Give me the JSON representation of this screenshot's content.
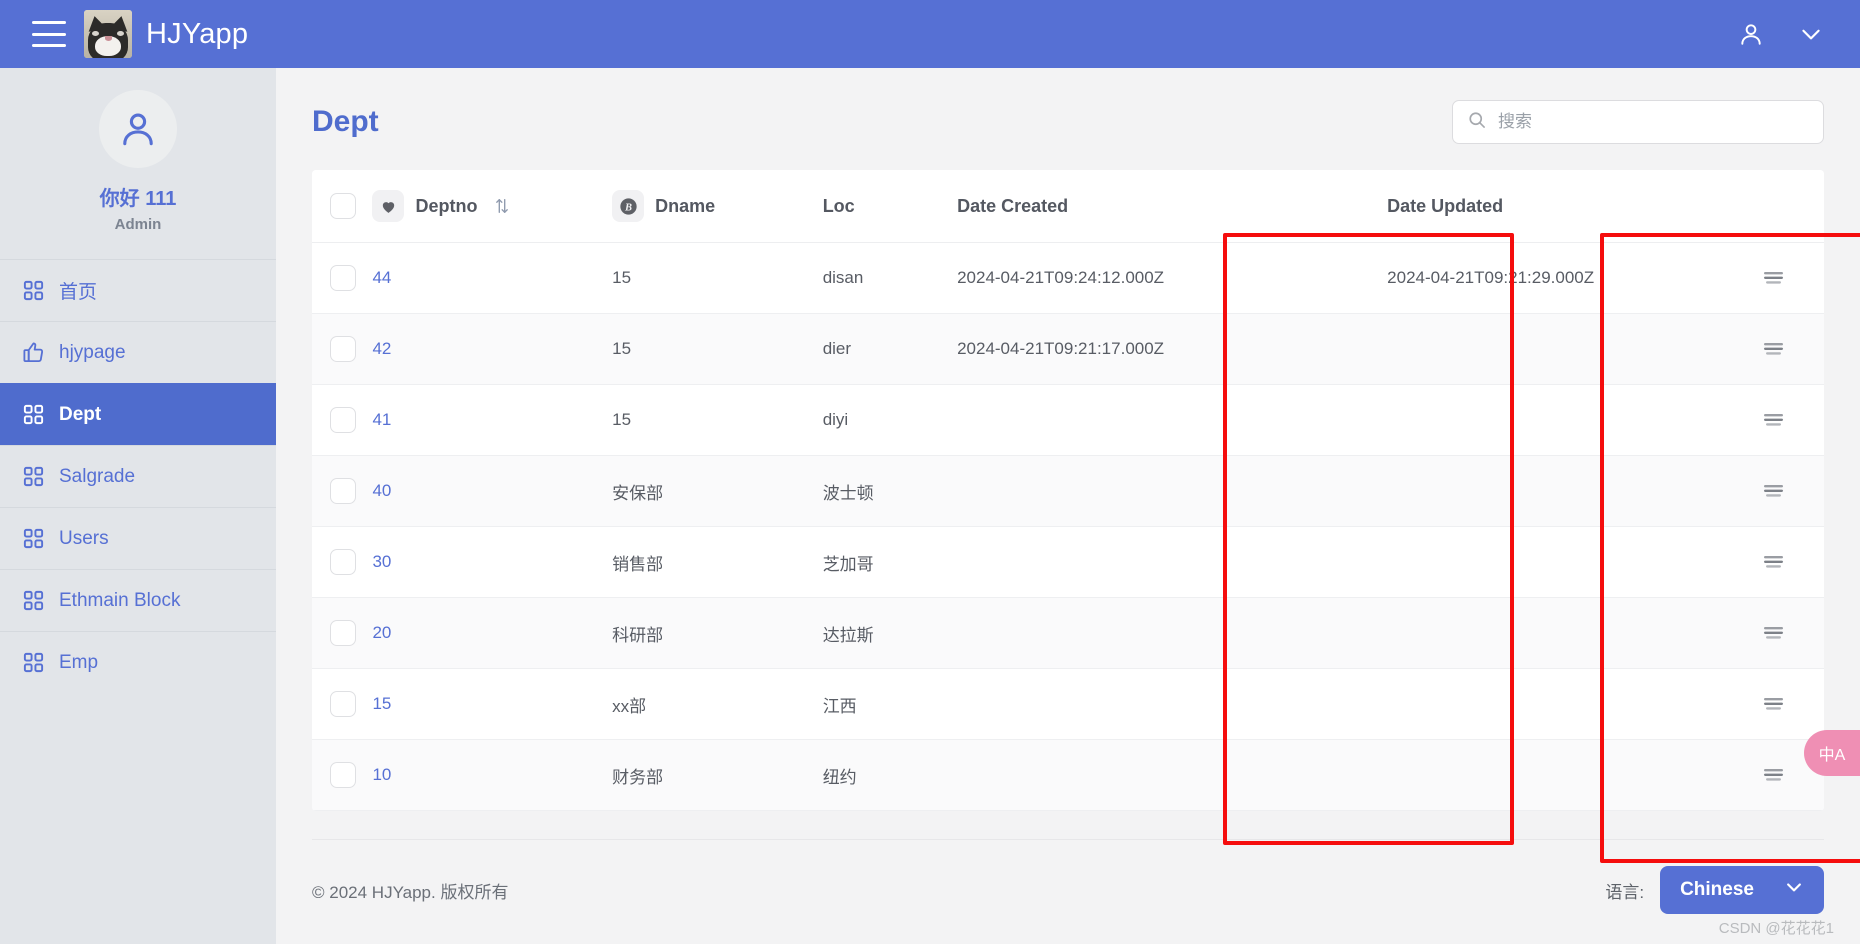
{
  "topbar": {
    "menu_icon": "hamburger-icon",
    "brand_title": "HJYapp",
    "account_icon": "person-icon",
    "chevron_icon": "chevron-down-icon"
  },
  "sidebar": {
    "avatar_icon": "person-icon",
    "greeting": "你好 111",
    "role": "Admin",
    "items": [
      {
        "label": "首页",
        "icon": "grid-icon",
        "active": false
      },
      {
        "label": "hjypage",
        "icon": "thumbs-up-icon",
        "active": false
      },
      {
        "label": "Dept",
        "icon": "grid-icon",
        "active": true
      },
      {
        "label": "Salgrade",
        "icon": "grid-icon",
        "active": false
      },
      {
        "label": "Users",
        "icon": "grid-icon",
        "active": false
      },
      {
        "label": "Ethmain Block",
        "icon": "grid-icon",
        "active": false
      },
      {
        "label": "Emp",
        "icon": "grid-icon",
        "active": false
      }
    ]
  },
  "main": {
    "page_title": "Dept",
    "search": {
      "placeholder": "搜索",
      "value": "",
      "icon": "search-icon"
    },
    "table": {
      "headers": {
        "deptno": "Deptno",
        "dname": "Dname",
        "loc": "Loc",
        "date_created": "Date Created",
        "date_updated": "Date Updated"
      },
      "header_icons": {
        "deptno": "heart-icon",
        "dname": "bitcoin-icon",
        "sort": "sort-arrows-icon"
      },
      "row_action_icon": "menu-lines-icon",
      "rows": [
        {
          "deptno": "44",
          "dname": "15",
          "loc": "disan",
          "date_created": "2024-04-21T09:24:12.000Z",
          "date_updated": "2024-04-21T09:21:29.000Z"
        },
        {
          "deptno": "42",
          "dname": "15",
          "loc": "dier",
          "date_created": "2024-04-21T09:21:17.000Z",
          "date_updated": ""
        },
        {
          "deptno": "41",
          "dname": "15",
          "loc": "diyi",
          "date_created": "",
          "date_updated": ""
        },
        {
          "deptno": "40",
          "dname": "安保部",
          "loc": "波士顿",
          "date_created": "",
          "date_updated": ""
        },
        {
          "deptno": "30",
          "dname": "销售部",
          "loc": "芝加哥",
          "date_created": "",
          "date_updated": ""
        },
        {
          "deptno": "20",
          "dname": "科研部",
          "loc": "达拉斯",
          "date_created": "",
          "date_updated": ""
        },
        {
          "deptno": "15",
          "dname": "xx部",
          "loc": "江西",
          "date_created": "",
          "date_updated": ""
        },
        {
          "deptno": "10",
          "dname": "财务部",
          "loc": "纽约",
          "date_created": "",
          "date_updated": ""
        }
      ]
    }
  },
  "footer": {
    "copyright": "© 2024 HJYapp. 版权所有",
    "lang_label": "语言:",
    "lang_value": "Chinese",
    "lang_chevron": "chevron-down-icon",
    "watermark": "CSDN @花花花1"
  },
  "fab": {
    "label": "中A",
    "icon": "translate-icon"
  },
  "annotations": {
    "highlight_color": "#f50d0d",
    "boxes": [
      {
        "name": "date-created-column",
        "label": "Date Created"
      },
      {
        "name": "date-updated-column",
        "label": "Date Updated"
      }
    ]
  }
}
